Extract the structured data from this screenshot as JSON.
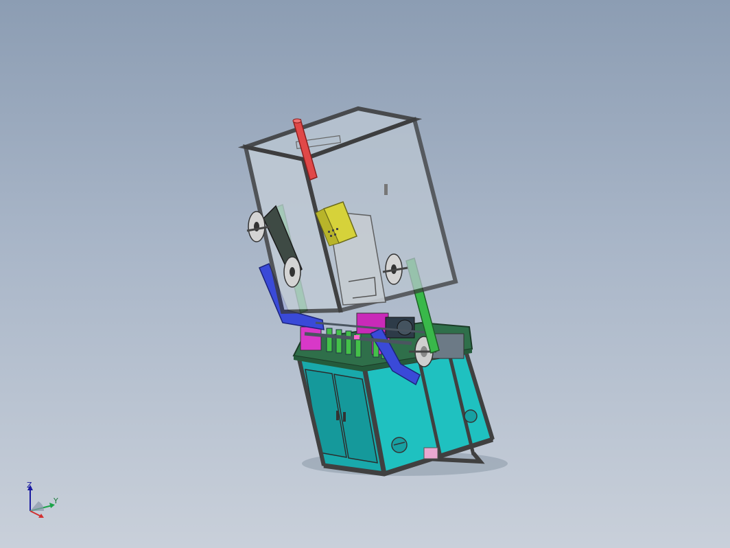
{
  "app": {
    "name": "CAD 3D viewport"
  },
  "colors": {
    "background_top": "#8c9db3",
    "background_bottom": "#c9d0da",
    "frame": "#3a3a3a",
    "glass": "#c8d2dc",
    "cabinet": "#1fb4b4",
    "cabinet_dark": "#168f92",
    "tabletop": "#2f6f4a",
    "control_box": "#d6d23a",
    "pipe": "#e04848",
    "arm": "#3a4ad8",
    "magenta": "#d838c8",
    "green_rail": "#39b84a"
  },
  "triad": {
    "axis_z": "Z",
    "axis_y": "Y"
  },
  "icons": [
    "coordinate-triad-icon"
  ]
}
